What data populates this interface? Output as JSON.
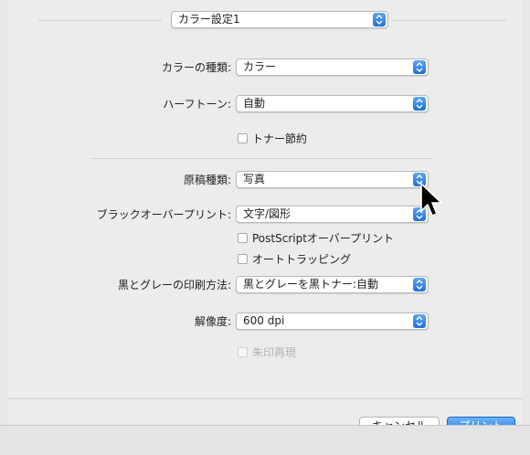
{
  "preset": {
    "value": "カラー設定1"
  },
  "fields": {
    "color_type": {
      "label": "カラーの種類:",
      "value": "カラー"
    },
    "halftone": {
      "label": "ハーフトーン:",
      "value": "自動"
    },
    "toner_save": {
      "label": "トナー節約",
      "checked": false
    },
    "original_type": {
      "label": "原稿種類:",
      "value": "写真"
    },
    "black_overprint": {
      "label": "ブラックオーバープリント:",
      "value": "文字/図形"
    },
    "postscript_overprint": {
      "label": "PostScriptオーバープリント",
      "checked": false
    },
    "auto_trapping": {
      "label": "オートトラッピング",
      "checked": false
    },
    "bw_print_method": {
      "label": "黒とグレーの印刷方法:",
      "value": "黒とグレーを黒トナー:自動"
    },
    "resolution": {
      "label": "解像度:",
      "value": "600 dpi"
    },
    "vermilion_reproduction": {
      "label": "朱印再現",
      "checked": false,
      "disabled": true
    }
  },
  "buttons": {
    "cancel": "キャンセル",
    "print": "プリント"
  },
  "colors": {
    "accent": "#1e70e0",
    "background": "#ececec"
  }
}
